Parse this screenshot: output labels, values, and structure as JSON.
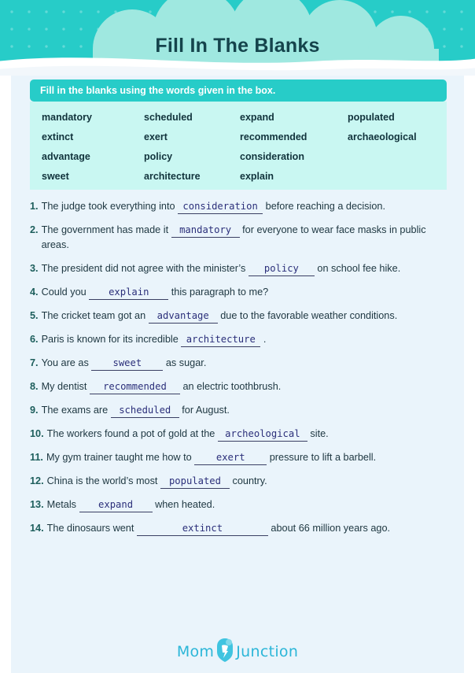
{
  "header": {
    "title": "Fill In The Blanks",
    "bg_color": "#27ccc8",
    "cloud_color": "#9fe8e0",
    "title_color": "#15444c"
  },
  "instruction": {
    "text": "Fill in the blanks using the words given in the box.",
    "bg_color": "#27ccc8"
  },
  "word_bank": {
    "bg_color": "#c9f7f2",
    "columns": [
      [
        "mandatory",
        "extinct",
        "advantage",
        "sweet"
      ],
      [
        "scheduled",
        "exert",
        "policy",
        "architecture"
      ],
      [
        "expand",
        "recommended",
        "consideration",
        "explain"
      ],
      [
        "populated",
        "archaeological",
        "",
        ""
      ]
    ]
  },
  "questions": [
    {
      "number": "1.",
      "before": "The judge took everything into ",
      "answer": "consideration",
      "answer_width": 104,
      "after": " before reaching a decision."
    },
    {
      "number": "2.",
      "before": "The government has made it ",
      "answer": "mandatory",
      "answer_width": 83,
      "after": " for everyone to wear face masks in public areas."
    },
    {
      "number": "3.",
      "before": "The president did not agree with the minister’s ",
      "answer": "policy",
      "answer_width": 80,
      "after": " on school fee hike."
    },
    {
      "number": "4.",
      "before": "Could you ",
      "answer": "explain",
      "answer_width": 97,
      "after": " this paragraph to me?"
    },
    {
      "number": "5.",
      "before": "The cricket team got an ",
      "answer": "advantage",
      "answer_width": 84,
      "after": " due to the favorable weather conditions."
    },
    {
      "number": "6.",
      "before": "Paris is known for its incredible ",
      "answer": "architecture",
      "answer_width": 97,
      "after": " ."
    },
    {
      "number": "7.",
      "before": "You are as ",
      "answer": "sweet",
      "answer_width": 87,
      "after": " as sugar."
    },
    {
      "number": "8.",
      "before": "My dentist ",
      "answer": "recommended",
      "answer_width": 111,
      "after": " an electric toothbrush."
    },
    {
      "number": "9.",
      "before": "The exams are ",
      "answer": "scheduled",
      "answer_width": 83,
      "after": " for August."
    },
    {
      "number": "10.",
      "before": "The workers found a pot of gold at the ",
      "answer": "archeological",
      "answer_width": 110,
      "after": " site."
    },
    {
      "number": "11.",
      "before": "My gym trainer taught me how to ",
      "answer": "exert",
      "answer_width": 88,
      "after": " pressure to lift a barbell."
    },
    {
      "number": "12.",
      "before": "China is the world’s most ",
      "answer": "populated",
      "answer_width": 84,
      "after": " country."
    },
    {
      "number": "13.",
      "before": "Metals ",
      "answer": "expand",
      "answer_width": 89,
      "after": " when heated."
    },
    {
      "number": "14.",
      "before": "The dinosaurs went ",
      "answer": "extinct",
      "answer_width": 163,
      "after": " about 66 million years ago."
    }
  ],
  "footer": {
    "logo_first": "Mom",
    "logo_second": "Junction",
    "logo_color": "#2bb6d8"
  }
}
